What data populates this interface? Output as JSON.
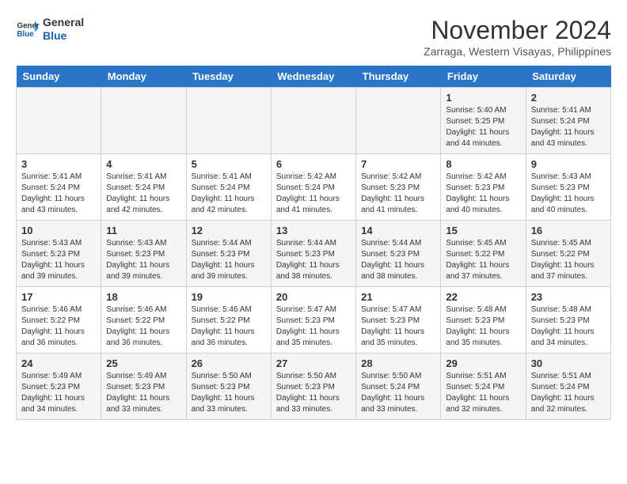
{
  "logo": {
    "line1": "General",
    "line2": "Blue"
  },
  "title": "November 2024",
  "location": "Zarraga, Western Visayas, Philippines",
  "days_of_week": [
    "Sunday",
    "Monday",
    "Tuesday",
    "Wednesday",
    "Thursday",
    "Friday",
    "Saturday"
  ],
  "weeks": [
    [
      {
        "day": "",
        "info": ""
      },
      {
        "day": "",
        "info": ""
      },
      {
        "day": "",
        "info": ""
      },
      {
        "day": "",
        "info": ""
      },
      {
        "day": "",
        "info": ""
      },
      {
        "day": "1",
        "info": "Sunrise: 5:40 AM\nSunset: 5:25 PM\nDaylight: 11 hours and 44 minutes."
      },
      {
        "day": "2",
        "info": "Sunrise: 5:41 AM\nSunset: 5:24 PM\nDaylight: 11 hours and 43 minutes."
      }
    ],
    [
      {
        "day": "3",
        "info": "Sunrise: 5:41 AM\nSunset: 5:24 PM\nDaylight: 11 hours and 43 minutes."
      },
      {
        "day": "4",
        "info": "Sunrise: 5:41 AM\nSunset: 5:24 PM\nDaylight: 11 hours and 42 minutes."
      },
      {
        "day": "5",
        "info": "Sunrise: 5:41 AM\nSunset: 5:24 PM\nDaylight: 11 hours and 42 minutes."
      },
      {
        "day": "6",
        "info": "Sunrise: 5:42 AM\nSunset: 5:24 PM\nDaylight: 11 hours and 41 minutes."
      },
      {
        "day": "7",
        "info": "Sunrise: 5:42 AM\nSunset: 5:23 PM\nDaylight: 11 hours and 41 minutes."
      },
      {
        "day": "8",
        "info": "Sunrise: 5:42 AM\nSunset: 5:23 PM\nDaylight: 11 hours and 40 minutes."
      },
      {
        "day": "9",
        "info": "Sunrise: 5:43 AM\nSunset: 5:23 PM\nDaylight: 11 hours and 40 minutes."
      }
    ],
    [
      {
        "day": "10",
        "info": "Sunrise: 5:43 AM\nSunset: 5:23 PM\nDaylight: 11 hours and 39 minutes."
      },
      {
        "day": "11",
        "info": "Sunrise: 5:43 AM\nSunset: 5:23 PM\nDaylight: 11 hours and 39 minutes."
      },
      {
        "day": "12",
        "info": "Sunrise: 5:44 AM\nSunset: 5:23 PM\nDaylight: 11 hours and 39 minutes."
      },
      {
        "day": "13",
        "info": "Sunrise: 5:44 AM\nSunset: 5:23 PM\nDaylight: 11 hours and 38 minutes."
      },
      {
        "day": "14",
        "info": "Sunrise: 5:44 AM\nSunset: 5:23 PM\nDaylight: 11 hours and 38 minutes."
      },
      {
        "day": "15",
        "info": "Sunrise: 5:45 AM\nSunset: 5:22 PM\nDaylight: 11 hours and 37 minutes."
      },
      {
        "day": "16",
        "info": "Sunrise: 5:45 AM\nSunset: 5:22 PM\nDaylight: 11 hours and 37 minutes."
      }
    ],
    [
      {
        "day": "17",
        "info": "Sunrise: 5:46 AM\nSunset: 5:22 PM\nDaylight: 11 hours and 36 minutes."
      },
      {
        "day": "18",
        "info": "Sunrise: 5:46 AM\nSunset: 5:22 PM\nDaylight: 11 hours and 36 minutes."
      },
      {
        "day": "19",
        "info": "Sunrise: 5:46 AM\nSunset: 5:22 PM\nDaylight: 11 hours and 36 minutes."
      },
      {
        "day": "20",
        "info": "Sunrise: 5:47 AM\nSunset: 5:23 PM\nDaylight: 11 hours and 35 minutes."
      },
      {
        "day": "21",
        "info": "Sunrise: 5:47 AM\nSunset: 5:23 PM\nDaylight: 11 hours and 35 minutes."
      },
      {
        "day": "22",
        "info": "Sunrise: 5:48 AM\nSunset: 5:23 PM\nDaylight: 11 hours and 35 minutes."
      },
      {
        "day": "23",
        "info": "Sunrise: 5:48 AM\nSunset: 5:23 PM\nDaylight: 11 hours and 34 minutes."
      }
    ],
    [
      {
        "day": "24",
        "info": "Sunrise: 5:49 AM\nSunset: 5:23 PM\nDaylight: 11 hours and 34 minutes."
      },
      {
        "day": "25",
        "info": "Sunrise: 5:49 AM\nSunset: 5:23 PM\nDaylight: 11 hours and 33 minutes."
      },
      {
        "day": "26",
        "info": "Sunrise: 5:50 AM\nSunset: 5:23 PM\nDaylight: 11 hours and 33 minutes."
      },
      {
        "day": "27",
        "info": "Sunrise: 5:50 AM\nSunset: 5:23 PM\nDaylight: 11 hours and 33 minutes."
      },
      {
        "day": "28",
        "info": "Sunrise: 5:50 AM\nSunset: 5:24 PM\nDaylight: 11 hours and 33 minutes."
      },
      {
        "day": "29",
        "info": "Sunrise: 5:51 AM\nSunset: 5:24 PM\nDaylight: 11 hours and 32 minutes."
      },
      {
        "day": "30",
        "info": "Sunrise: 5:51 AM\nSunset: 5:24 PM\nDaylight: 11 hours and 32 minutes."
      }
    ]
  ]
}
